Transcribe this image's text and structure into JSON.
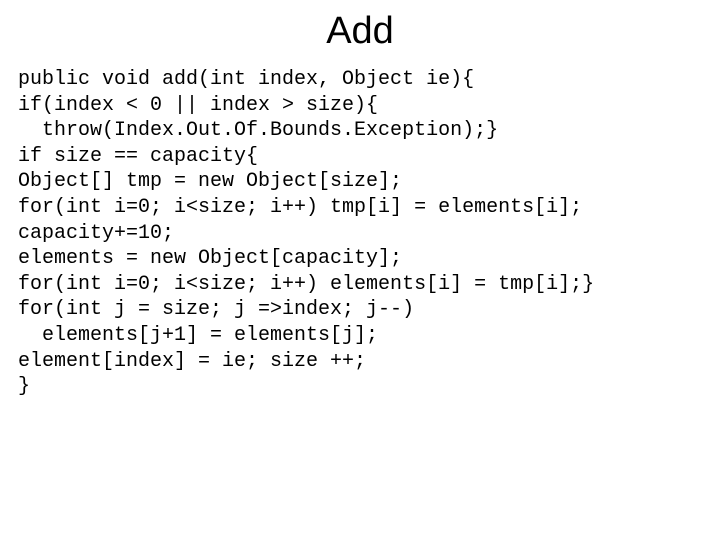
{
  "title": "Add",
  "code": {
    "l1": "public void add(int index, Object ie){",
    "l2": "if(index < 0 || index > size){",
    "l3": "  throw(Index.Out.Of.Bounds.Exception);}",
    "l4": "if size == capacity{",
    "l5": "Object[] tmp = new Object[size];",
    "l6": "for(int i=0; i<size; i++) tmp[i] = elements[i];",
    "l7": "capacity+=10;",
    "l8": "elements = new Object[capacity];",
    "l9": "for(int i=0; i<size; i++) elements[i] = tmp[i];}",
    "l10": "for(int j = size; j =>index; j--)",
    "l11": "  elements[j+1] = elements[j];",
    "l12": "element[index] = ie; size ++;",
    "l13": "}"
  }
}
